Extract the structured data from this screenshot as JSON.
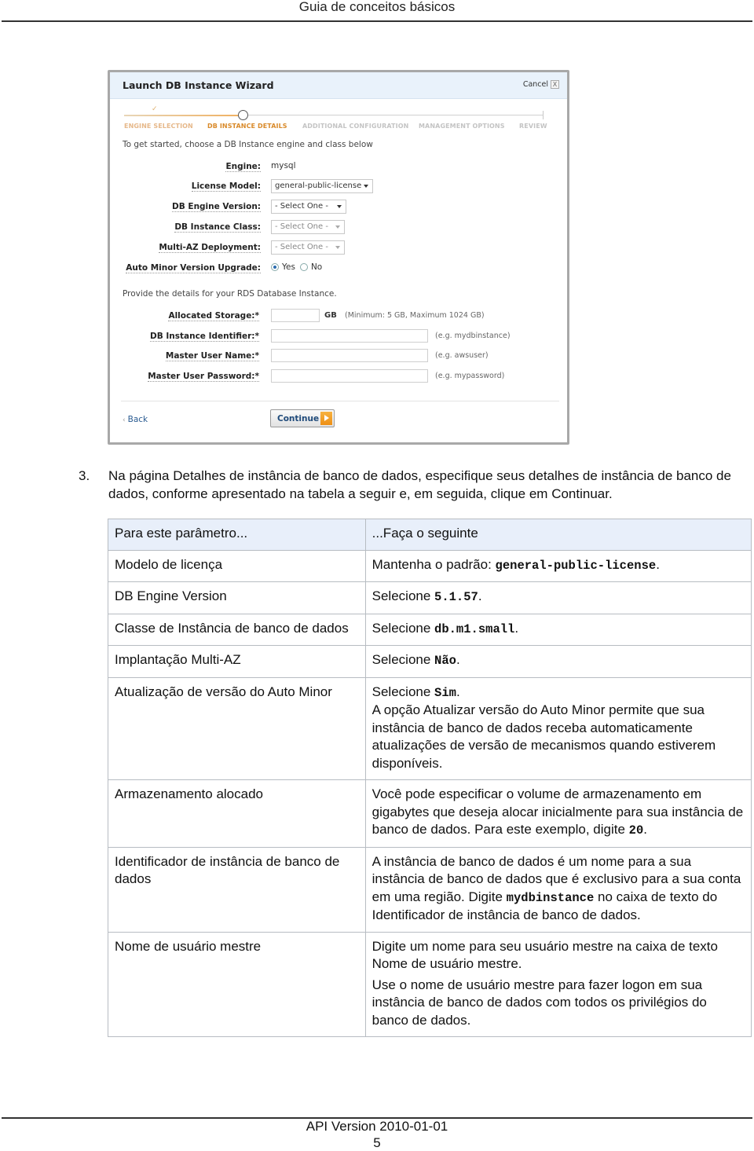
{
  "header": {
    "title": "Guia de conceitos básicos"
  },
  "wizard": {
    "title": "Launch DB Instance Wizard",
    "cancel_label": "Cancel",
    "close_glyph": "X",
    "progress_check_glyph": "✓",
    "steps": [
      {
        "label": "ENGINE SELECTION",
        "state": "done"
      },
      {
        "label": "DB INSTANCE DETAILS",
        "state": "current"
      },
      {
        "label": "ADDITIONAL CONFIGURATION",
        "state": "todo"
      },
      {
        "label": "MANAGEMENT OPTIONS",
        "state": "todo"
      },
      {
        "label": "REVIEW",
        "state": "todo"
      }
    ],
    "intro": "To get started, choose a DB Instance engine and class below",
    "engine": {
      "label": "Engine:",
      "value": "mysql"
    },
    "license_model": {
      "label": "License Model:",
      "value": "general-public-license"
    },
    "db_engine_version": {
      "label": "DB Engine Version:",
      "value": "- Select One -"
    },
    "db_instance_class": {
      "label": "DB Instance Class:",
      "value": "- Select One -"
    },
    "multi_az": {
      "label": "Multi-AZ Deployment:",
      "value": "- Select One -"
    },
    "auto_minor": {
      "label": "Auto Minor Version Upgrade:",
      "yes_label": "Yes",
      "no_label": "No",
      "selected": "Yes"
    },
    "provide": "Provide the details for your RDS Database Instance.",
    "allocated_storage": {
      "label": "Allocated Storage:*",
      "value": "",
      "unit": "GB",
      "hint": "(Minimum: 5 GB, Maximum 1024 GB)"
    },
    "db_instance_identifier": {
      "label": "DB Instance Identifier:*",
      "value": "",
      "hint": "(e.g. mydbinstance)"
    },
    "master_user_name": {
      "label": "Master User Name:*",
      "value": "",
      "hint": "(e.g. awsuser)"
    },
    "master_user_password": {
      "label": "Master User Password:*",
      "value": "",
      "hint": "(e.g. mypassword)"
    },
    "back_label": "Back",
    "back_glyph": "‹",
    "continue_label": "Continue"
  },
  "step": {
    "number": "3.",
    "text": "Na página Detalhes de instância de banco de dados, especifique seus detalhes de instância de banco de dados, conforme apresentado na tabela a seguir e, em seguida, clique em Continuar."
  },
  "table": {
    "headers": [
      "Para este parâmetro...",
      "...Faça o seguinte"
    ],
    "rows": [
      {
        "param": "Modelo de licença",
        "action": {
          "pre": "Mantenha o padrão: ",
          "code": "general-public-license",
          "post": "."
        }
      },
      {
        "param": "DB Engine Version",
        "action": {
          "pre": "Selecione ",
          "code": "5.1.57",
          "post": "."
        }
      },
      {
        "param": "Classe de Instância de banco de dados",
        "action": {
          "pre": "Selecione ",
          "code": "db.m1.small",
          "post": "."
        }
      },
      {
        "param": "Implantação Multi-AZ",
        "action": {
          "pre": "Selecione ",
          "code": "Não",
          "post": "."
        }
      },
      {
        "param": "Atualização de versão do Auto Minor",
        "action": {
          "pre": "Selecione ",
          "code": "Sim",
          "post": ".",
          "extra": "A opção Atualizar versão do Auto Minor permite que sua instância de banco de dados receba automaticamente atualizações de versão de mecanismos quando estiverem disponíveis."
        }
      },
      {
        "param": "Armazenamento alocado",
        "action": {
          "pre": "Você pode especificar o volume de armazenamento em gigabytes que deseja alocar inicialmente para sua instância de banco de dados. Para este exemplo, digite ",
          "code": "20",
          "post": "."
        }
      },
      {
        "param": "Identificador de instância de banco de dados",
        "action": {
          "pre": "A instância de banco de dados é um nome para a sua instância de banco de dados que é exclusivo para a sua conta em uma região. Digite ",
          "code": "mydbinstance",
          "post": " no caixa de texto do Identificador de instância de banco de dados."
        }
      },
      {
        "param": "Nome de usuário mestre",
        "action": {
          "pre": "Digite um nome para seu usuário mestre na caixa de texto Nome de usuário mestre.",
          "code": "",
          "post": "",
          "extra": "Use o nome de usuário mestre para fazer logon em sua instância de banco de dados com todos os privilégios do banco de dados."
        }
      }
    ]
  },
  "footer": {
    "api_version": "API Version 2010-01-01",
    "page_number": "5"
  }
}
